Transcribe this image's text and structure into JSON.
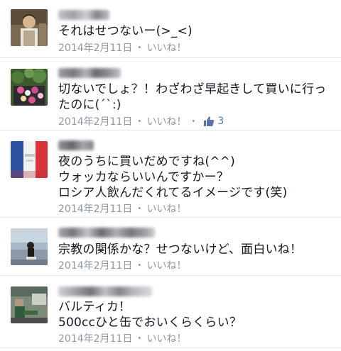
{
  "comments": [
    {
      "text": "それはせつないー(>_<)",
      "date": "2014年2月11日",
      "dot": "・",
      "like_label": "いいね！"
    },
    {
      "text": "切ないでしょ？！わざわざ早起きして買いに行ったのに(´`:)",
      "date": "2014年2月11日",
      "dot": "・",
      "like_label": "いいね！",
      "dot2": "・",
      "like_count": "3"
    },
    {
      "text": "夜のうちに買いだめですね(^^)\nウォッカならいいんですかー？\nロシア人飲んだくれてるイメージです(笑)",
      "date": "2014年2月11日",
      "dot": "・",
      "like_label": "いいね！"
    },
    {
      "text": "宗教の関係かな？せつないけど、面白いね！",
      "date": "2014年2月11日",
      "dot": "・",
      "like_label": "いいね！"
    },
    {
      "text": "バルティカ！\n500ccひと缶でおいくらくらい？",
      "date": "2014年2月11日",
      "dot": "・",
      "like_label": "いいね！"
    }
  ],
  "colors": {
    "text": "#141823",
    "meta": "#9197a3",
    "link": "#5b74a8",
    "divider": "#e3e4e8"
  },
  "icons": {
    "like": "thumbs-up-icon"
  }
}
